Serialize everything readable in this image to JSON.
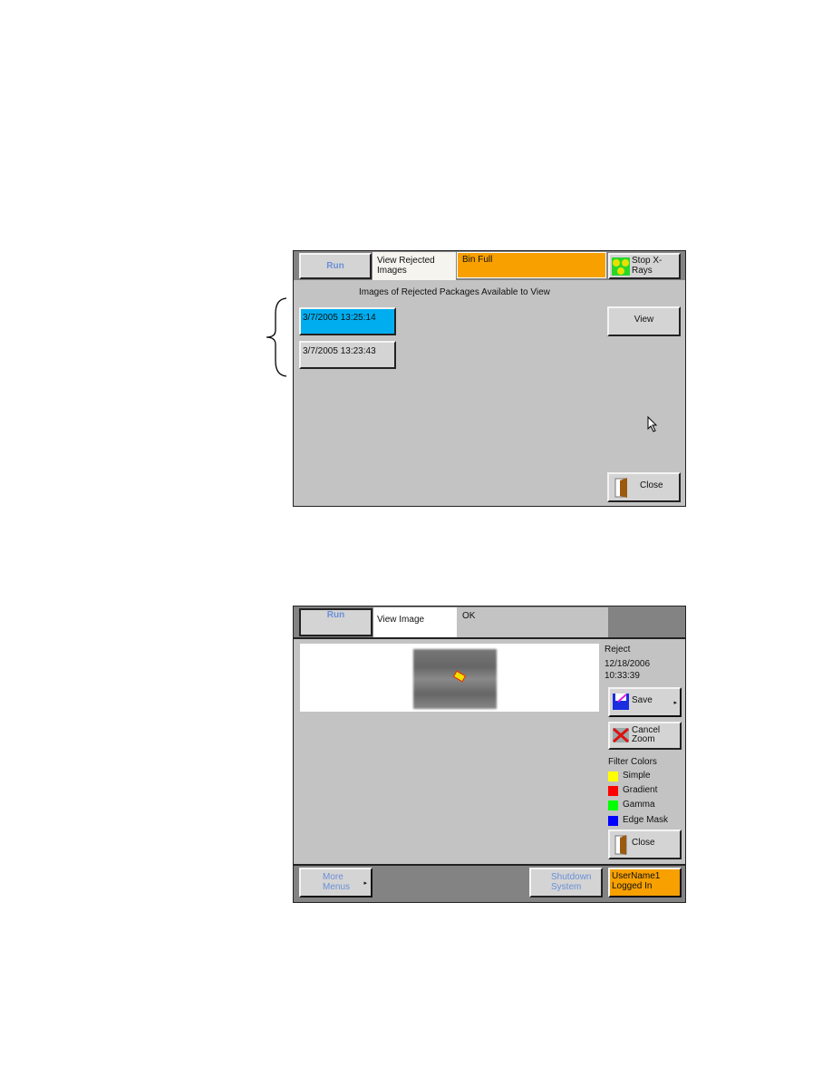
{
  "screen1": {
    "run": "Run",
    "tab": "View Rejected Images",
    "status": "Bin Full",
    "stop_xrays": "Stop X-Rays",
    "heading": "Images of Rejected Packages Available to View",
    "items": [
      "3/7/2005 13:25:14",
      "3/7/2005 13:23:43"
    ],
    "view": "View",
    "close": "Close",
    "colors": {
      "status": "#f7a000",
      "selected": "#00aef0"
    }
  },
  "screen2": {
    "run": "Run",
    "tab": "View Image",
    "status": "OK",
    "reject": "Reject",
    "date": "12/18/2006",
    "time": "10:33:39",
    "save": "Save",
    "cancel_zoom": "Cancel Zoom",
    "filter_title": "Filter Colors",
    "filters": [
      {
        "label": "Simple",
        "color": "#ffff00"
      },
      {
        "label": "Gradient",
        "color": "#ff0000"
      },
      {
        "label": "Gamma",
        "color": "#00ff00"
      },
      {
        "label": "Edge Mask",
        "color": "#0000ff"
      }
    ],
    "close": "Close",
    "more_menus": "More Menus",
    "shutdown": "Shutdown System",
    "user": "UserName1",
    "logged_in": "Logged In"
  }
}
